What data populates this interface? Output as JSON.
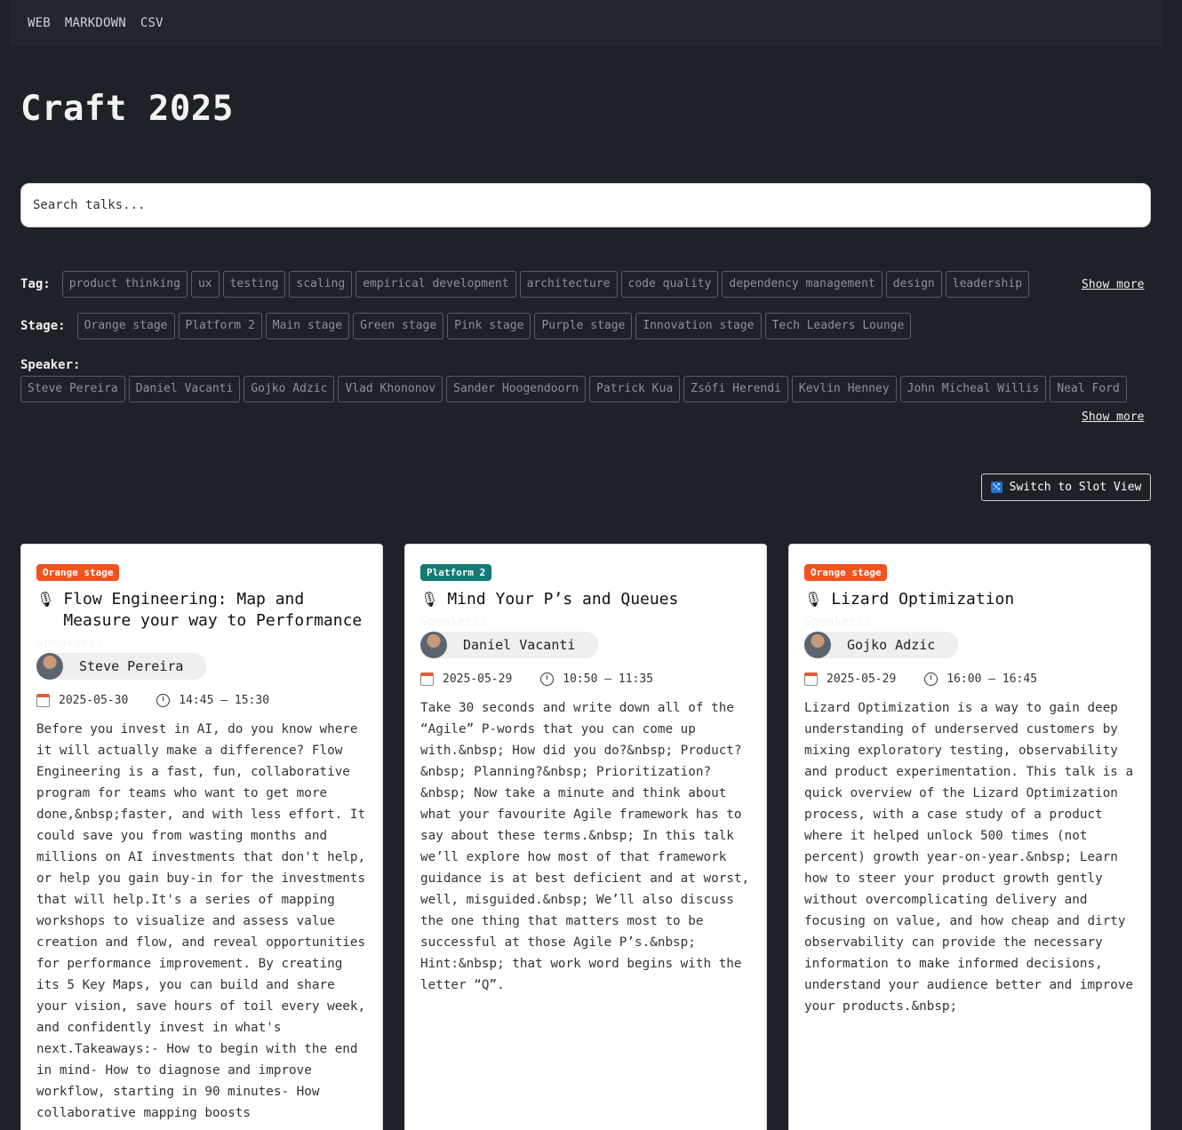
{
  "nav": [
    "WEB",
    "MARKDOWN",
    "CSV"
  ],
  "title": "Craft 2025",
  "subtitle": "",
  "search": {
    "placeholder": "Search talks..."
  },
  "filters": {
    "tag": {
      "label": "Tag:",
      "items": [
        "product thinking",
        "ux",
        "testing",
        "scaling",
        "empirical development",
        "architecture",
        "code quality",
        "dependency management",
        "design",
        "leadership"
      ],
      "show_more": "Show more"
    },
    "stage": {
      "label": "Stage:",
      "items": [
        "Orange stage",
        "Platform 2",
        "Main stage",
        "Green stage",
        "Pink stage",
        "Purple stage",
        "Innovation stage",
        "Tech Leaders Lounge"
      ]
    },
    "speaker": {
      "label": "Speaker:",
      "items": [
        "Steve Pereira",
        "Daniel Vacanti",
        "Gojko Adzic",
        "Vlad Khononov",
        "Sander Hoogendoorn",
        "Patrick Kua",
        "Zsófi Herendi",
        "Kevlin Henney",
        "John Micheal Willis",
        "Neal Ford"
      ],
      "show_more": "Show more"
    }
  },
  "switch_button": "Switch to Slot View",
  "speakers_label": "Speakers:",
  "talks": [
    {
      "stage": "Orange stage",
      "stage_color": "#f0541e",
      "title": "Flow Engineering: Map and Measure your way to Performance",
      "speaker": "Steve Pereira",
      "date": "2025-05-30",
      "time": "14:45 – 15:30",
      "description": "Before you invest in AI, do you know where it will actually make a difference? Flow Engineering is a fast, fun, collaborative program for teams who want to get more done,&nbsp;faster, and with less effort. It could save you from wasting months and millions on AI investments that don't help, or help you gain buy-in for the investments that will help.It's a series of mapping workshops to visualize and assess value creation and flow, and reveal opportunities for performance improvement. By creating its 5 Key Maps, you can build and share your vision, save hours of toil every week, and confidently invest in what's next.Takeaways:- How to begin with the end in mind- How to diagnose and improve workflow, starting in 90 minutes- How collaborative mapping boosts"
    },
    {
      "stage": "Platform 2",
      "stage_color": "#137b74",
      "title": "Mind Your P’s and Queues",
      "speaker": "Daniel Vacanti",
      "date": "2025-05-29",
      "time": "10:50 – 11:35",
      "description": "Take 30 seconds and write down all of the “Agile” P-words that you can come up with.&nbsp; How did you do?&nbsp; Product?&nbsp; Planning?&nbsp; Prioritization?&nbsp; Now take a minute and think about what your favourite Agile framework has to say about these terms.&nbsp; In this talk we’ll explore how most of that framework guidance is at best deficient and at worst, well, misguided.&nbsp; We’ll also discuss the one thing that matters most to be successful at those Agile P’s.&nbsp; Hint:&nbsp; that work word begins with the letter “Q”."
    },
    {
      "stage": "Orange stage",
      "stage_color": "#f0541e",
      "title": "Lizard Optimization",
      "speaker": "Gojko Adzic",
      "date": "2025-05-29",
      "time": "16:00 – 16:45",
      "description": "Lizard Optimization is a way to gain deep understanding of underserved customers by mixing exploratory testing, observability and product experimentation. This talk is a quick overview of the Lizard Optimization process, with a case study of a product where it helped unlock 500 times (not percent) growth year-on-year.&nbsp; Learn how to steer your product growth gently without overcomplicating delivery and focusing on value, and how cheap and dirty observability can provide the necessary information to make informed decisions, understand your audience better and improve your products.&nbsp;"
    }
  ]
}
